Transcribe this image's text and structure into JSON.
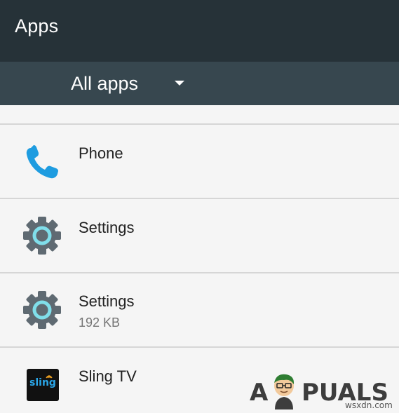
{
  "header": {
    "title": "Apps"
  },
  "filter": {
    "selected": "All apps"
  },
  "apps": [
    {
      "name": "Phone",
      "size": "",
      "icon": "phone-icon"
    },
    {
      "name": "Settings",
      "size": "",
      "icon": "gear-icon"
    },
    {
      "name": "Settings",
      "size": "192 KB",
      "icon": "gear-icon"
    },
    {
      "name": "Sling TV",
      "size": "",
      "icon": "sling-tv-icon"
    }
  ],
  "sling_logo_text": "sling",
  "watermark": {
    "brand_a": "A",
    "brand_rest": "PUALS",
    "site": "wsxdn.com"
  },
  "colors": {
    "app_bar": "#263238",
    "filter_bar": "#37474f",
    "list_bg": "#f5f5f5",
    "phone_blue": "#1e9ce0",
    "gear_gray": "#5f6a72",
    "gear_ring": "#80deea"
  }
}
